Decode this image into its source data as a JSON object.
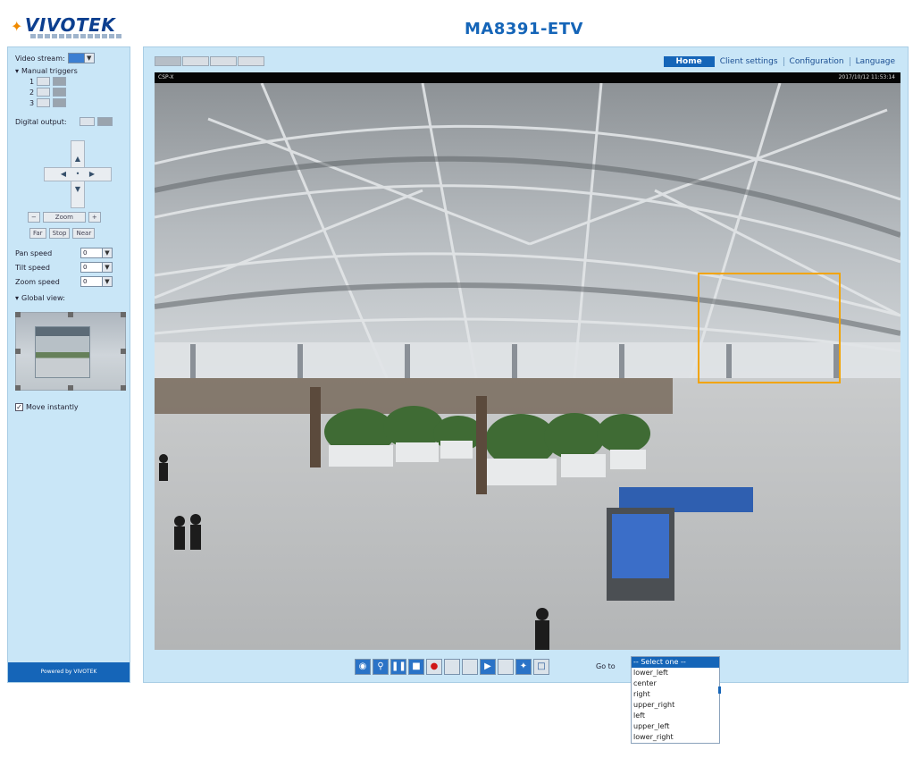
{
  "header": {
    "logo_text": "VIVOTEK",
    "model": "MA8391-ETV"
  },
  "sidebar": {
    "video_stream_label": "Video stream:",
    "manual_triggers_label": "Manual triggers",
    "trigger_numbers": [
      "1",
      "2",
      "3"
    ],
    "digital_output_label": "Digital output:",
    "zoom_label": "Zoom",
    "focus_buttons": [
      "Far",
      "Stop",
      "Near"
    ],
    "pan_speed_label": "Pan speed",
    "tilt_speed_label": "Tilt speed",
    "zoom_speed_label": "Zoom speed",
    "speed_value": "0",
    "global_view_label": "Global view:",
    "move_instantly_label": "Move instantly",
    "move_instantly_checked": true,
    "powered_by": "Powered by VIVOTEK"
  },
  "nav": {
    "home": "Home",
    "client_settings": "Client settings",
    "configuration": "Configuration",
    "language": "Language"
  },
  "video": {
    "title": "CSP-X",
    "timestamp": "2017/10/12 11:53:14"
  },
  "control_bar": {
    "buttons": [
      "snapshot",
      "digital-zoom",
      "pause",
      "stop",
      "record",
      "volume",
      "mute",
      "talk",
      "mic",
      "fullscreen",
      "pip"
    ],
    "goto_label": "Go to"
  },
  "preset_dropdown": {
    "items": [
      "-- Select one --",
      "lower_left",
      "center",
      "right",
      "upper_right",
      "left",
      "upper_left",
      "lower_right"
    ],
    "selected_index": 0
  },
  "colors": {
    "accent": "#1565b8",
    "panel_bg": "#c9e6f7",
    "roi": "#f2a400"
  }
}
